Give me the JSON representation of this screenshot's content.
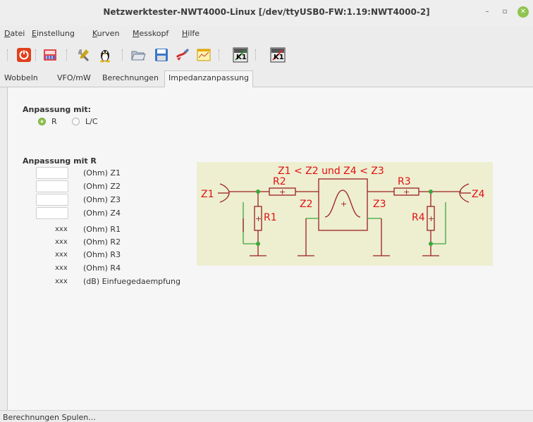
{
  "window": {
    "title": "Netzwerktester-NWT4000-Linux [/dev/ttyUSB0-FW:1.19:NWT4000-2]",
    "min_glyph": "–",
    "max_glyph": "▫",
    "close_glyph": "✕"
  },
  "menu": [
    {
      "first": "D",
      "rest": "atei"
    },
    {
      "first": "E",
      "rest": "instellung"
    },
    {
      "first": "K",
      "rest": "urven"
    },
    {
      "first": "M",
      "rest": "esskopf"
    },
    {
      "first": "H",
      "rest": "ilfe"
    }
  ],
  "toolbar": {
    "icons": [
      "power-icon",
      "memory-chip-icon",
      "tools-icon",
      "tux-penguin-icon",
      "open-folder-icon",
      "save-disk-icon",
      "edit-brush-icon",
      "window-chart-icon",
      "k1-probe-icon",
      "k1-probe-alt-icon"
    ]
  },
  "tabs": [
    "Wobbeln",
    "VFO/mW",
    "Berechnungen",
    "Impedanzanpassung"
  ],
  "match_with": {
    "title": "Anpassung mit:",
    "options": [
      "R",
      "L/C"
    ],
    "selected": "R"
  },
  "match_r": {
    "title": "Anpassung mit R",
    "inputs": [
      {
        "value": "",
        "unit": "(Ohm) Z1"
      },
      {
        "value": "",
        "unit": "(Ohm) Z2"
      },
      {
        "value": "",
        "unit": "(Ohm) Z3"
      },
      {
        "value": "",
        "unit": "(Ohm) Z4"
      }
    ],
    "results": [
      {
        "value": "xxx",
        "unit": "(Ohm) R1"
      },
      {
        "value": "xxx",
        "unit": "(Ohm) R2"
      },
      {
        "value": "xxx",
        "unit": "(Ohm) R3"
      },
      {
        "value": "xxx",
        "unit": "(Ohm) R4"
      },
      {
        "value": "xxx",
        "unit": "(dB) Einfuegedaempfung"
      }
    ]
  },
  "diagram": {
    "heading": "Z1 < Z2 und Z4 < Z3",
    "labels": {
      "z1": "Z1",
      "z2": "Z2",
      "z3": "Z3",
      "z4": "Z4",
      "r1": "R1",
      "r2": "R2",
      "r3": "R3",
      "r4": "R4"
    },
    "colors": {
      "background": "#eeeed1",
      "wire": "#9b2020",
      "label": "#e01010",
      "ground": "#3aa83a",
      "node": "#3aa83a"
    }
  },
  "status": {
    "text": "Berechnungen Spulen..."
  }
}
